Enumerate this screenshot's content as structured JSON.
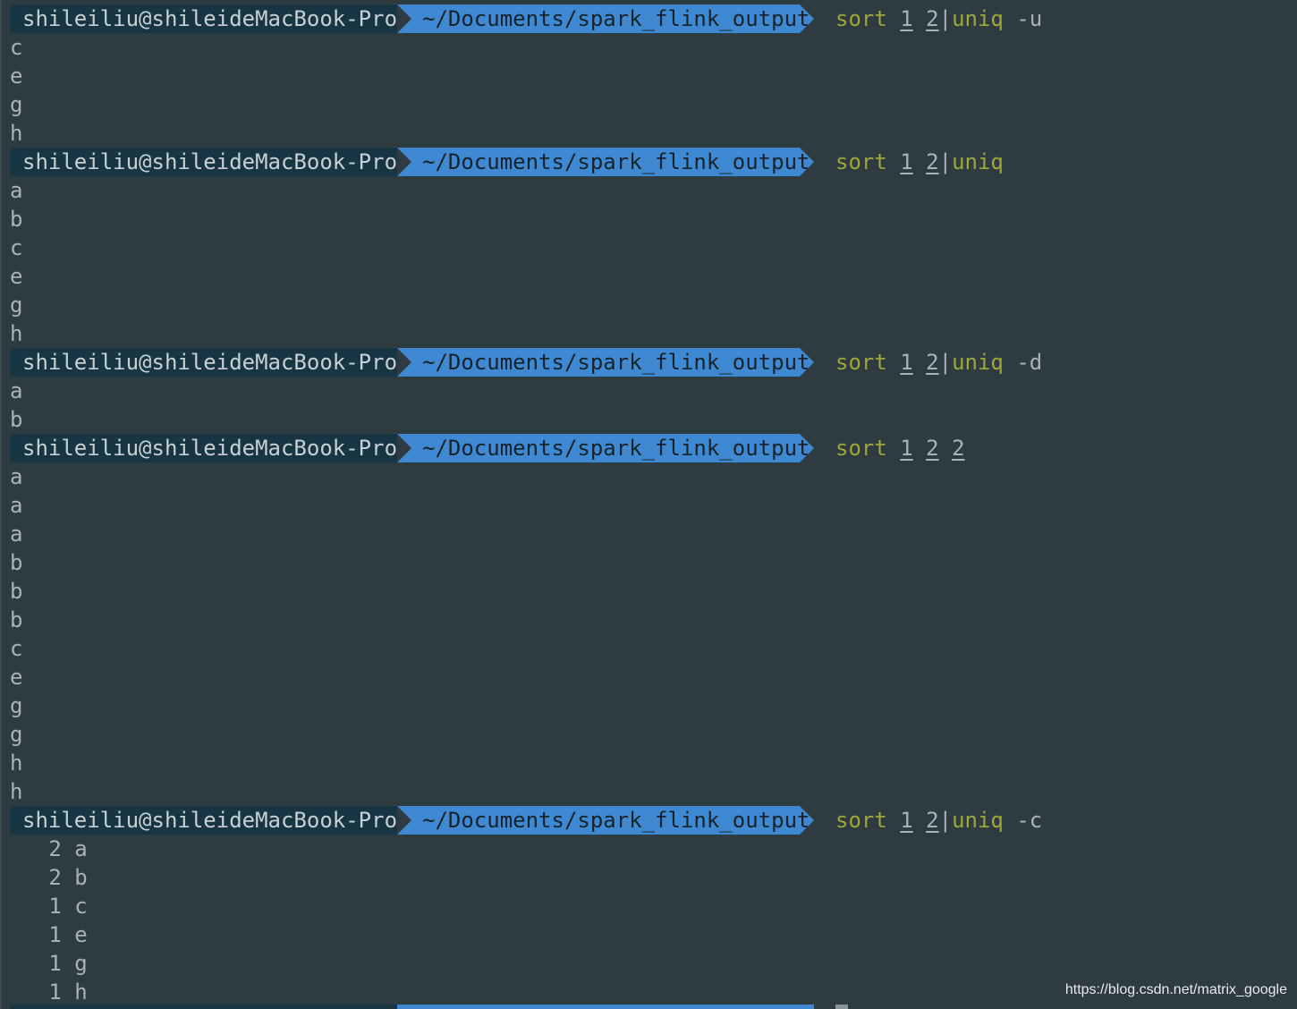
{
  "prompt": {
    "user_host": "shileiliu@shileideMacBook-Pro",
    "path": "~/Documents/spark_flink_output"
  },
  "blocks": [
    {
      "command": {
        "name": "sort",
        "args": [
          "1",
          "2"
        ],
        "pipe": "|",
        "pipe_cmd": "uniq",
        "flag": "-u"
      },
      "output": [
        "c",
        "e",
        "g",
        "h"
      ]
    },
    {
      "command": {
        "name": "sort",
        "args": [
          "1",
          "2"
        ],
        "pipe": "|",
        "pipe_cmd": "uniq",
        "flag": ""
      },
      "output": [
        "a",
        "b",
        "c",
        "e",
        "g",
        "h"
      ]
    },
    {
      "command": {
        "name": "sort",
        "args": [
          "1",
          "2"
        ],
        "pipe": "|",
        "pipe_cmd": "uniq",
        "flag": "-d"
      },
      "output": [
        "a",
        "b"
      ]
    },
    {
      "command": {
        "name": "sort",
        "args": [
          "1",
          "2",
          "2"
        ],
        "pipe": "",
        "pipe_cmd": "",
        "flag": ""
      },
      "output": [
        "a",
        "a",
        "a",
        "b",
        "b",
        "b",
        "c",
        "e",
        "g",
        "g",
        "h",
        "h"
      ]
    },
    {
      "command": {
        "name": "sort",
        "args": [
          "1",
          "2"
        ],
        "pipe": "|",
        "pipe_cmd": "uniq",
        "flag": "-c"
      },
      "output": [
        "   2 a",
        "   2 b",
        "   1 c",
        "   1 e",
        "   1 g",
        "   1 h"
      ]
    }
  ],
  "watermark": "https://blog.csdn.net/matrix_google",
  "colors": {
    "background": "#2e3b41",
    "user_segment": "#173543",
    "path_segment": "#3e89d1",
    "command": "#9ea83a",
    "text": "#a9b2b6"
  }
}
